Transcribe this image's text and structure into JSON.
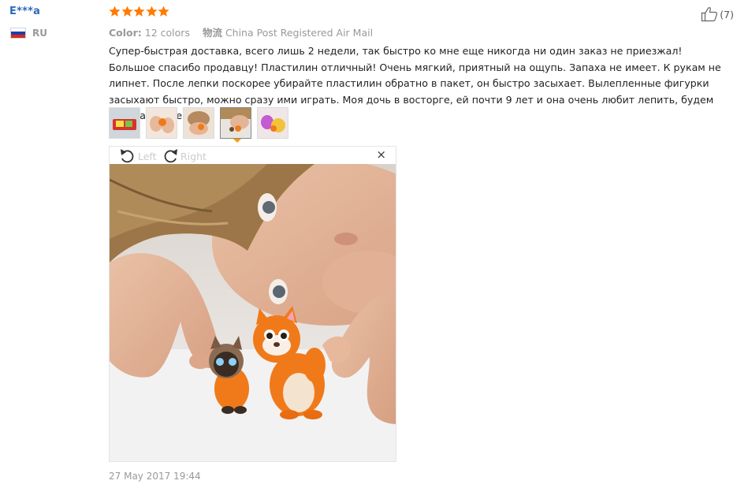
{
  "user": {
    "name": "E***a",
    "country": "RU"
  },
  "review": {
    "rating": 5,
    "color_label": "Color:",
    "color_value": "12 colors",
    "shipping_label": "物流",
    "shipping_value": "China Post Registered Air Mail",
    "helpful_count": "(7)",
    "text": "Супер-быстрая доставка, всего лишь 2 недели, так быстро ко мне еще никогда ни один заказ не приезжал! Большое спасибо продавцу! Пластилин отличный! Очень мягкий, приятный на ощупь. Запаха не имеет. К рукам не липнет. После лепки поскорее убирайте пластилин обратно в пакет, он быстро засыхает. Вылепленные фигурки засыхают быстро, можно сразу ими играть. Моя дочь в восторге, ей почти 9 лет и она очень любит лепить, будем покупать еще!",
    "date": "27 May 2017 19:44"
  },
  "viewer": {
    "rotate_left": "Left",
    "rotate_right": "Right",
    "close": "×"
  },
  "colors": {
    "star": "#ff7b00",
    "user_link": "#2c6ab8",
    "active_arrow": "#ff9900"
  }
}
